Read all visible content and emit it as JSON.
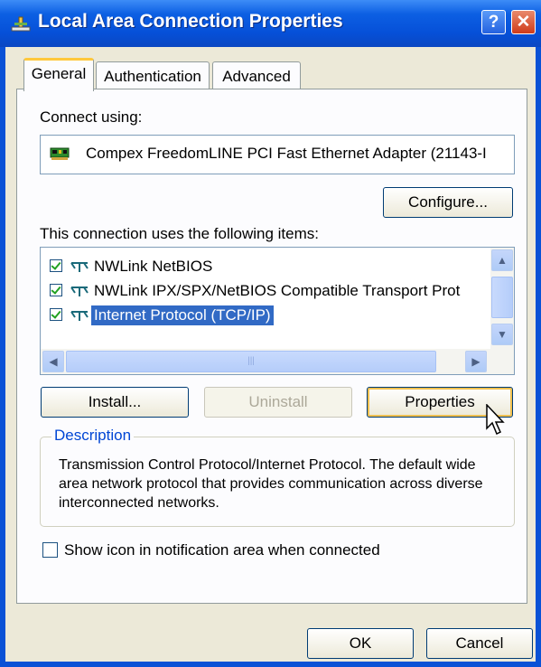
{
  "window": {
    "title": "Local Area Connection Properties"
  },
  "tabs": [
    {
      "label": "General",
      "active": true
    },
    {
      "label": "Authentication",
      "active": false
    },
    {
      "label": "Advanced",
      "active": false
    }
  ],
  "general": {
    "connect_using_label": "Connect using:",
    "adapter_name": "Compex FreedomLINE PCI Fast Ethernet Adapter (21143-I",
    "configure_button": "Configure...",
    "items_label": "This connection uses the following items:",
    "items": [
      {
        "label": "NWLink NetBIOS",
        "checked": true,
        "selected": false
      },
      {
        "label": "NWLink IPX/SPX/NetBIOS Compatible Transport Prot",
        "checked": true,
        "selected": false
      },
      {
        "label": "Internet Protocol (TCP/IP)",
        "checked": true,
        "selected": true
      }
    ],
    "install_button": "Install...",
    "uninstall_button": "Uninstall",
    "properties_button": "Properties",
    "description_title": "Description",
    "description_text": "Transmission Control Protocol/Internet Protocol. The default wide area network protocol that provides communication across diverse interconnected networks.",
    "notify_checkbox_label": "Show icon in notification area when connected",
    "notify_checked": false
  },
  "footer": {
    "ok_button": "OK",
    "cancel_button": "Cancel"
  },
  "colors": {
    "title_bar": "#0a52d6",
    "selection": "#316ac5",
    "group_title": "#0046d5"
  }
}
